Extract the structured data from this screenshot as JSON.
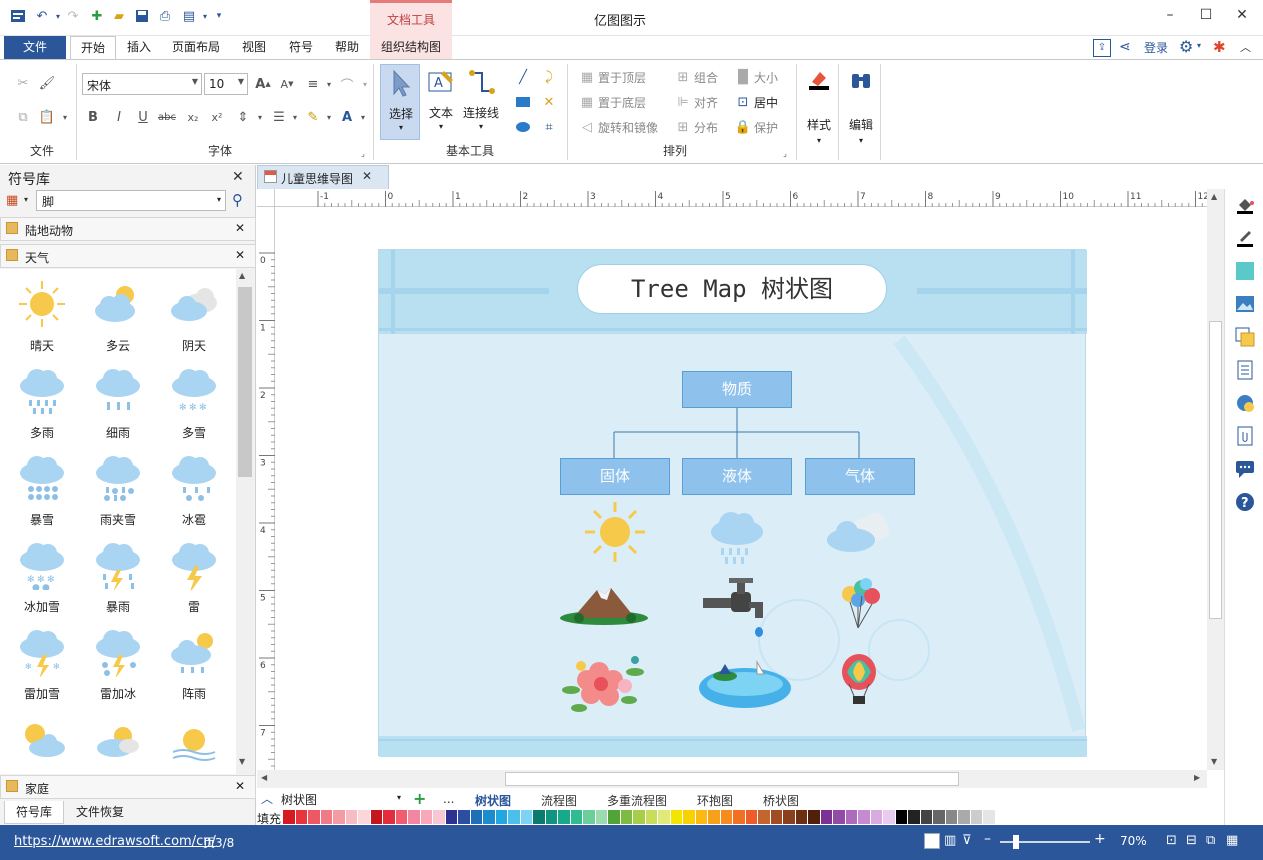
{
  "app": {
    "title": "亿图图示",
    "context_group": "文档工具"
  },
  "ribbon_tabs": [
    "文件",
    "开始",
    "插入",
    "页面布局",
    "视图",
    "符号",
    "帮助",
    "组织结构图"
  ],
  "account": {
    "login": "登录"
  },
  "ribbon": {
    "font_name": "宋体",
    "font_size": "10",
    "groups": {
      "file": "文件",
      "font": "字体",
      "basic_tools": "基本工具",
      "arrange": "排列"
    },
    "tools": {
      "select": "选择",
      "text": "文本",
      "connector": "连接线",
      "style": "样式",
      "edit": "编辑"
    },
    "arrange": {
      "bring_front": "置于顶层",
      "send_back": "置于底层",
      "rotate_mirror": "旋转和镜像",
      "group": "组合",
      "align": "对齐",
      "distribute": "分布",
      "size": "大小",
      "center": "居中",
      "protect": "保护"
    }
  },
  "library": {
    "title": "符号库",
    "search_value": "脚",
    "sections": {
      "land_animals": "陆地动物",
      "weather": "天气",
      "home": "家庭"
    },
    "symbols": [
      "晴天",
      "多云",
      "阴天",
      "多雨",
      "细雨",
      "多雪",
      "暴雪",
      "雨夹雪",
      "冰雹",
      "冰加雪",
      "暴雨",
      "雷",
      "雷加雪",
      "雷加冰",
      "阵雨"
    ],
    "bottom_tabs": [
      "符号库",
      "文件恢复"
    ]
  },
  "document": {
    "tab_title": "儿童思维导图",
    "ruler_h": [
      "-1",
      "0",
      "1",
      "2",
      "3",
      "4",
      "5",
      "6",
      "7",
      "8",
      "9",
      "10",
      "11",
      "12"
    ],
    "ruler_v": [
      "0",
      "1",
      "2",
      "3",
      "4",
      "5",
      "6",
      "7"
    ],
    "diagram": {
      "title": "Tree Map  树状图",
      "root": "物质",
      "children": [
        "固体",
        "液体",
        "气体"
      ]
    }
  },
  "sheets": {
    "current": "树状图",
    "ellipsis": "...",
    "tabs": [
      "树状图",
      "流程图",
      "多重流程图",
      "环抱图",
      "桥状图"
    ]
  },
  "fill_label": "填充",
  "palette": [
    "#d71920",
    "#e8353b",
    "#ec5964",
    "#f07b87",
    "#f59ba5",
    "#f8bbc2",
    "#fbd6db",
    "#c4161c",
    "#e32d3c",
    "#f25c6f",
    "#f487a0",
    "#f7a8bb",
    "#f9c6d3",
    "#2e3192",
    "#2b4ea2",
    "#1f6fb6",
    "#1b8ccd",
    "#22a7e0",
    "#4bc0ec",
    "#7dd3f3",
    "#0b7b6f",
    "#0f9580",
    "#17a98a",
    "#2fbd8f",
    "#6ccf99",
    "#9bdcae",
    "#51a538",
    "#7dbb42",
    "#a8cd4a",
    "#c9dc5c",
    "#e0ea7a",
    "#f3e500",
    "#f9d100",
    "#fcb813",
    "#f9a01b",
    "#f68b1f",
    "#f36f21",
    "#ef5b2b",
    "#c2662d",
    "#a14c22",
    "#8b3f1b",
    "#6d2f14",
    "#522009",
    "#7b3294",
    "#944ba8",
    "#ae6bbd",
    "#c58bd0",
    "#d9abe1",
    "#e9cbef",
    "#000000",
    "#222222",
    "#444444",
    "#666666",
    "#888888",
    "#aaaaaa",
    "#cccccc",
    "#e5e5e5",
    "#ffffff"
  ],
  "status": {
    "url": "https://www.edrawsoft.com/cn/",
    "page": "页3/8",
    "zoom": "70%"
  },
  "colors": {
    "accent": "#2b579a",
    "node": "#8ec2ec",
    "canvas_bg": "#dbeef8"
  }
}
